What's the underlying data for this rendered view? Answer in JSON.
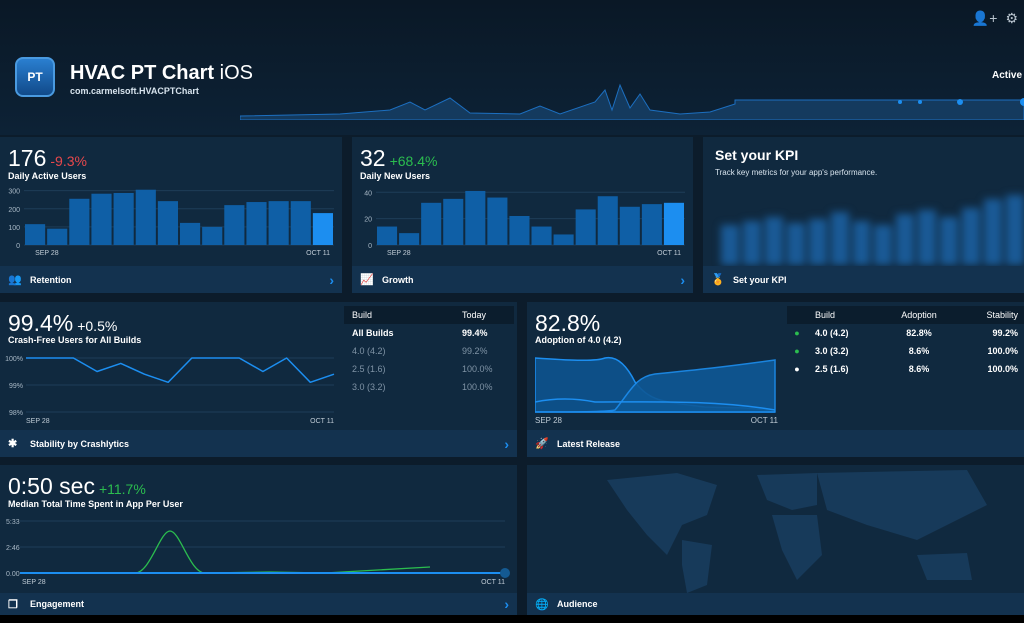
{
  "header": {
    "app_name": "HVAC PT Chart",
    "platform": "iOS",
    "bundle_id": "com.carmelsoft.HVACPTChart",
    "logo_text": "PT",
    "status": "Active",
    "icons": [
      "add-user-icon",
      "gear-icon"
    ]
  },
  "colors": {
    "accent": "#1c8ef0",
    "positive": "#2bbd4f",
    "negative": "#e8484c",
    "card": "#10293f"
  },
  "dau": {
    "value": "176",
    "delta": "-9.3%",
    "label": "Daily Active Users",
    "footer": "Retention",
    "x_start": "SEP 28",
    "x_end": "OCT 11",
    "chart_data": {
      "type": "bar",
      "values": [
        115,
        90,
        255,
        283,
        287,
        305,
        242,
        122,
        100,
        220,
        237,
        242,
        242,
        176
      ],
      "yticks": [
        "0",
        "100",
        "200",
        "300"
      ],
      "ylim": [
        0,
        320
      ]
    }
  },
  "dnu": {
    "value": "32",
    "delta": "+68.4%",
    "label": "Daily New Users",
    "footer": "Growth",
    "x_start": "SEP 28",
    "x_end": "OCT 11",
    "chart_data": {
      "type": "bar",
      "values": [
        14,
        9,
        32,
        35,
        41,
        36,
        22,
        14,
        8,
        27,
        37,
        29,
        31,
        32
      ],
      "yticks": [
        "0",
        "20",
        "40"
      ],
      "ylim": [
        0,
        44
      ]
    }
  },
  "kpi": {
    "title": "Set your KPI",
    "subtitle": "Track key metrics for your app's performance.",
    "footer": "Set your KPI"
  },
  "stability": {
    "value": "99.4%",
    "delta": "+0.5%",
    "label": "Crash-Free Users for All Builds",
    "footer": "Stability by Crashlytics",
    "x_start": "SEP 28",
    "x_end": "OCT 11",
    "chart_data": {
      "type": "line",
      "values": [
        100,
        100,
        100,
        99.5,
        99.8,
        99.4,
        99.1,
        100,
        100,
        100,
        99.5,
        100,
        99.1,
        99.4
      ],
      "yticks": [
        "100%",
        "99%",
        "98%"
      ],
      "ylim": [
        98,
        100
      ]
    },
    "table": {
      "headers": [
        "Build",
        "Today"
      ],
      "rows": [
        [
          "All Builds",
          "99.4%"
        ],
        [
          "4.0 (4.2)",
          "99.2%"
        ],
        [
          "2.5 (1.6)",
          "100.0%"
        ],
        [
          "3.0 (3.2)",
          "100.0%"
        ]
      ]
    }
  },
  "release": {
    "value": "82.8%",
    "label": "Adoption of 4.0 (4.2)",
    "footer": "Latest Release",
    "x_start": "SEP 28",
    "x_end": "OCT 11",
    "table": {
      "headers": [
        "Build",
        "Adoption",
        "Stability"
      ],
      "rows": [
        {
          "build": "4.0 (4.2)",
          "adoption": "82.8%",
          "stability": "99.2%",
          "dot": "#2bbd4f"
        },
        {
          "build": "3.0 (3.2)",
          "adoption": "8.6%",
          "stability": "100.0%",
          "dot": "#2bbd4f"
        },
        {
          "build": "2.5 (1.6)",
          "adoption": "8.6%",
          "stability": "100.0%",
          "dot": "#ffffff"
        }
      ]
    }
  },
  "engagement": {
    "value": "0:50 sec",
    "delta": "+11.7%",
    "label": "Median Total Time Spent in App Per User",
    "footer": "Engagement",
    "x_start": "SEP 28",
    "x_end": "OCT 11",
    "yticks": [
      "5:33",
      "2:46",
      "0.00"
    ]
  },
  "audience": {
    "footer": "Audience"
  }
}
